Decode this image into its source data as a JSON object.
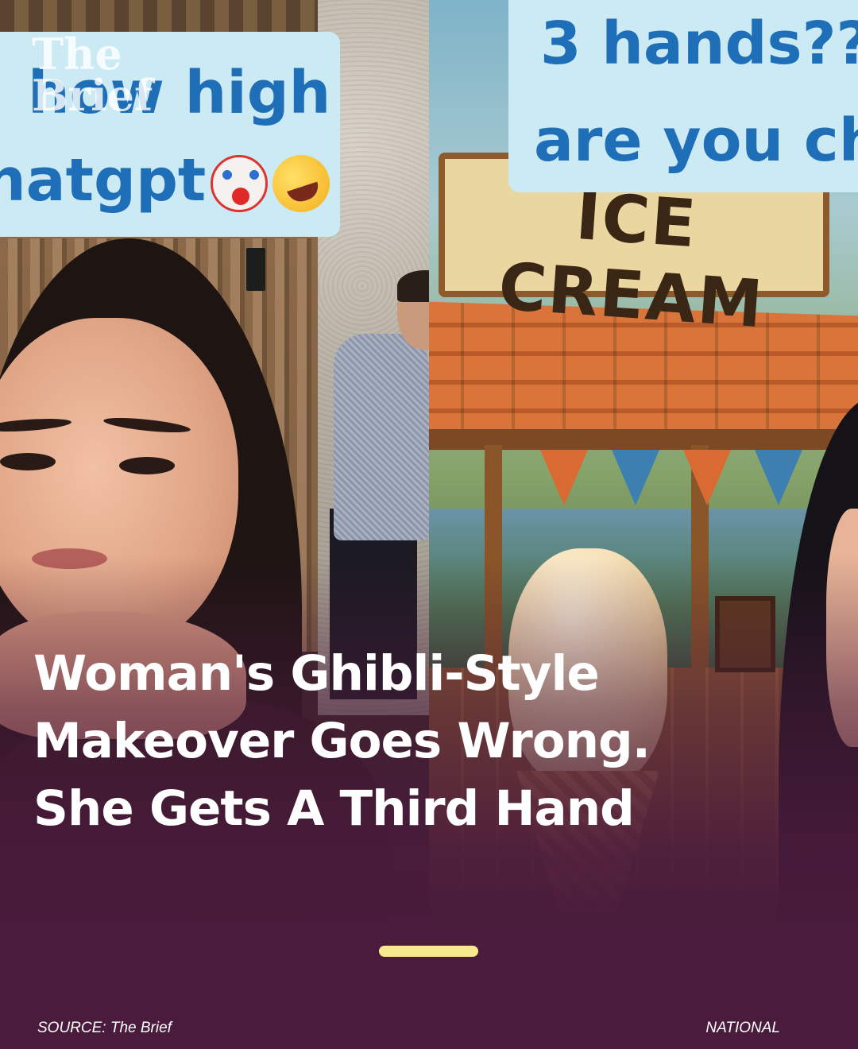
{
  "watermark": {
    "line1": "The",
    "line2": "Brief"
  },
  "photo_caption": {
    "line1": "how high",
    "line2": "hatgpt",
    "emojis": [
      "clown-face",
      "rolling-on-floor-laughing"
    ]
  },
  "art_caption": {
    "line1": "3 hands??",
    "line2": "are you ch"
  },
  "shop_sign": "ICE CREAM",
  "headline": "Woman's Ghibli-Style Makeover Goes Wrong. She Gets A Third Hand",
  "progress": {
    "current": 1,
    "total": 1
  },
  "footer": {
    "source": "SOURCE: The Brief",
    "category": "NATIONAL"
  },
  "colors": {
    "background": "#4a1b3c",
    "caption_text": "#1f6fb8",
    "caption_bg": "#cbeaf3",
    "progress": "#f7ea8e",
    "headline": "#ffffff"
  }
}
